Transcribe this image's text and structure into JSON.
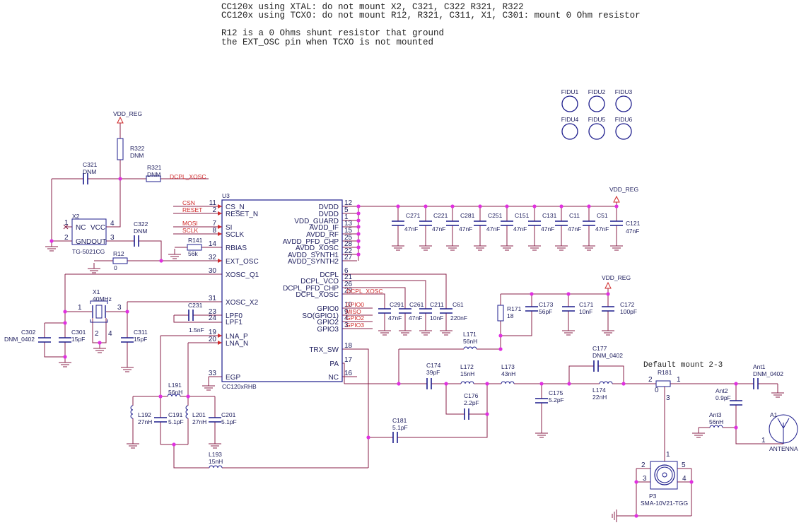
{
  "notes": [
    "CC120x using XTAL: do not mount X2, C321, C322 R321, R322",
    "CC120x using TCXO: do not mount R12, R321, C311, X1, C301: mount 0 Ohm resistor",
    "R12 is a 0 Ohms shunt resistor that ground",
    "the EXT_OSC pin when TCXO is not mounted"
  ],
  "fiducials": [
    "FIDU1",
    "FIDU2",
    "FIDU3",
    "FIDU4",
    "FIDU5",
    "FIDU6"
  ],
  "u3": {
    "ref": "U3",
    "part": "CC120xRHB",
    "left_pins": [
      {
        "num": "11",
        "name": "CS_N"
      },
      {
        "num": "2",
        "name": "RESET_N"
      },
      {
        "num": "7",
        "name": "SI"
      },
      {
        "num": "8",
        "name": "SCLK"
      },
      {
        "num": "14",
        "name": "RBIAS"
      },
      {
        "num": "32",
        "name": "EXT_OSC"
      },
      {
        "num": "30",
        "name": "XOSC_Q1"
      },
      {
        "num": "31",
        "name": "XOSC_X2"
      },
      {
        "num": "23",
        "name": "LPF0"
      },
      {
        "num": "24",
        "name": "LPF1"
      },
      {
        "num": "19",
        "name": "LNA_P"
      },
      {
        "num": "20",
        "name": "LNA_N"
      },
      {
        "num": "33",
        "name": "EGP"
      }
    ],
    "right_pins": [
      {
        "num": "12",
        "name": "DVDD"
      },
      {
        "num": "5",
        "name": "DVDD"
      },
      {
        "num": "1",
        "name": "VDD_GUARD"
      },
      {
        "num": "13",
        "name": "AVDD_IF"
      },
      {
        "num": "15",
        "name": "AVDD_RF"
      },
      {
        "num": "25",
        "name": "AVDD_PFD_CHP"
      },
      {
        "num": "28",
        "name": "AVDD_XOSC"
      },
      {
        "num": "22",
        "name": "AVDD_SYNTH1"
      },
      {
        "num": "27",
        "name": "AVDD_SYNTH2"
      },
      {
        "num": "6",
        "name": "DCPL"
      },
      {
        "num": "21",
        "name": "DCPL_VCO"
      },
      {
        "num": "26",
        "name": "DCPL_PFD_CHP"
      },
      {
        "num": "29",
        "name": "DCPL_XOSC"
      },
      {
        "num": "10",
        "name": "GPIO0"
      },
      {
        "num": "9",
        "name": "SO(GPIO1)"
      },
      {
        "num": "4",
        "name": "GPIO2"
      },
      {
        "num": "3",
        "name": "GPIO3"
      },
      {
        "num": "18",
        "name": "TRX_SW"
      },
      {
        "num": "17",
        "name": "PA"
      },
      {
        "num": "16",
        "name": "NC"
      }
    ]
  },
  "nets": {
    "vdd_reg": "VDD_REG",
    "dcpl_xosc": "DCPL_XOSC",
    "csn": "CSN",
    "reset": "RESET",
    "mosi": "MOSI",
    "sclk": "SCLK",
    "gpio0": "GPIO0",
    "miso": "MISO",
    "gpio2": "GPIO2",
    "gpio3": "GPIO3"
  },
  "x2": {
    "ref": "X2",
    "nc": "NC",
    "vcc": "VCC",
    "gndout": "GNDOUT",
    "part": "TG-5021CG",
    "pins": [
      "1",
      "2",
      "3",
      "4"
    ]
  },
  "x1": {
    "ref": "X1",
    "value": "40MHz",
    "pins": [
      "1",
      "2",
      "3",
      "4"
    ]
  },
  "r181": {
    "ref": "R181",
    "pins": [
      "2",
      "0",
      "1",
      "3"
    ],
    "note": "Default mount 2-3"
  },
  "p3": {
    "ref": "P3",
    "part": "SMA-10V21-TGG",
    "pins": [
      "1",
      "2",
      "3",
      "4",
      "5"
    ]
  },
  "a1": {
    "ref": "A1",
    "label": "ANTENNA",
    "pin": "1"
  },
  "components": {
    "C321": {
      "ref": "C321",
      "value": "DNM"
    },
    "R322": {
      "ref": "R322",
      "value": "DNM"
    },
    "R321": {
      "ref": "R321",
      "value": "DNM"
    },
    "C322": {
      "ref": "C322",
      "value": "DNM"
    },
    "R12": {
      "ref": "R12",
      "value": "0"
    },
    "R141": {
      "ref": "R141",
      "value": "56k"
    },
    "C302": {
      "ref": "C302",
      "value": "DNM_0402"
    },
    "C301": {
      "ref": "C301",
      "value": "15pF"
    },
    "C311": {
      "ref": "C311",
      "value": "15pF"
    },
    "C231": {
      "ref": "C231",
      "value": "1.5nF"
    },
    "L191": {
      "ref": "L191",
      "value": "56nH"
    },
    "L192": {
      "ref": "L192",
      "value": "27nH"
    },
    "C191": {
      "ref": "C191",
      "value": "5.1pF"
    },
    "L201": {
      "ref": "L201",
      "value": "27nH"
    },
    "C201": {
      "ref": "C201",
      "value": "5.1pF"
    },
    "L193": {
      "ref": "L193",
      "value": "15nH"
    },
    "C271": {
      "ref": "C271",
      "value": "47nF"
    },
    "C221": {
      "ref": "C221",
      "value": "47nF"
    },
    "C281": {
      "ref": "C281",
      "value": "47nF"
    },
    "C251": {
      "ref": "C251",
      "value": "47nF"
    },
    "C151": {
      "ref": "C151",
      "value": "47nF"
    },
    "C131": {
      "ref": "C131",
      "value": "47nF"
    },
    "C11": {
      "ref": "C11",
      "value": "47nF"
    },
    "C51": {
      "ref": "C51",
      "value": "47nF"
    },
    "C121": {
      "ref": "C121",
      "value": "47nF"
    },
    "C291": {
      "ref": "C291",
      "value": "47nF"
    },
    "C261": {
      "ref": "C261",
      "value": "47nF"
    },
    "C211": {
      "ref": "C211",
      "value": "10nF"
    },
    "C61": {
      "ref": "C61",
      "value": "220nF"
    },
    "R171": {
      "ref": "R171",
      "value": "18"
    },
    "C173": {
      "ref": "C173",
      "value": "56pF"
    },
    "C171": {
      "ref": "C171",
      "value": "10nF"
    },
    "C172": {
      "ref": "C172",
      "value": "100pF"
    },
    "L171": {
      "ref": "L171",
      "value": "56nH"
    },
    "C174": {
      "ref": "C174",
      "value": "39pF"
    },
    "L172": {
      "ref": "L172",
      "value": "15nH"
    },
    "L173": {
      "ref": "L173",
      "value": "43nH"
    },
    "C176": {
      "ref": "C176",
      "value": "2.2pF"
    },
    "C181": {
      "ref": "C181",
      "value": "5.1pF"
    },
    "C175": {
      "ref": "C175",
      "value": "5.2pF"
    },
    "C177": {
      "ref": "C177",
      "value": "DNM_0402"
    },
    "L174": {
      "ref": "L174",
      "value": "22nH"
    },
    "Ant1": {
      "ref": "Ant1",
      "value": "DNM_0402"
    },
    "Ant2": {
      "ref": "Ant2",
      "value": "0.9pF"
    },
    "Ant3": {
      "ref": "Ant3",
      "value": "56nH"
    }
  },
  "colors": {
    "wire": "#8a2048",
    "component": "#1c1c8c",
    "net_label": "#d02a2a",
    "junction": "#e030e0"
  }
}
